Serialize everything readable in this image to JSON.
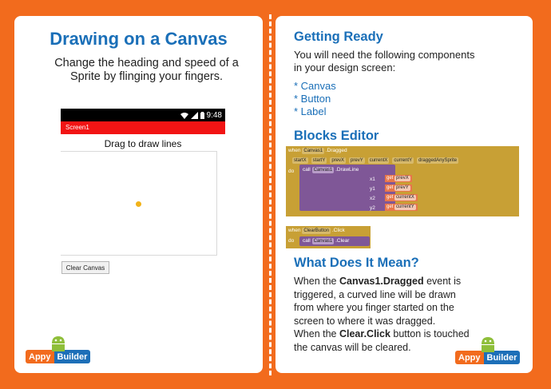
{
  "left": {
    "title": "Drawing on a Canvas",
    "subtitle": "Change the heading and speed of a Sprite by flinging your fingers.",
    "phone": {
      "time": "9:48",
      "screen_title": "Screen1",
      "label": "Drag to draw lines",
      "button": "Clear Canvas"
    }
  },
  "logo": {
    "appy": "Appy",
    "builder": "Builder"
  },
  "right": {
    "getting_ready": {
      "heading": "Getting Ready",
      "text_line1": "You will need the following components",
      "text_line2": "in your design screen:",
      "items": [
        "* Canvas",
        "* Button",
        "* Label"
      ]
    },
    "blocks_editor": {
      "heading": "Blocks Editor",
      "dragged": {
        "when": "when",
        "component": "Canvas1",
        "event": ".Dragged",
        "params": [
          "startX",
          "startY",
          "prevX",
          "prevY",
          "currentX",
          "currentY",
          "draggedAnySprite"
        ],
        "do": "do",
        "call": "call",
        "method": ".DrawLine",
        "args": [
          {
            "name": "x1",
            "value": "prevX"
          },
          {
            "name": "y1",
            "value": "prevY"
          },
          {
            "name": "x2",
            "value": "currentX"
          },
          {
            "name": "y2",
            "value": "currentY"
          }
        ],
        "get": "get"
      },
      "click": {
        "when": "when",
        "component": "ClearButton",
        "event": ".Click",
        "do": "do",
        "call": "call",
        "target": "Canvas1",
        "method": ".Clear"
      }
    },
    "meaning": {
      "heading": "What Does It Mean?",
      "p1_a": "When the ",
      "p1_b": "Canvas1.Dragged",
      "p1_c": " event is triggered, a curved line will be drawn from where you finger started on the screen to where it was dragged.",
      "p2_a": "When the ",
      "p2_b": "Clear.Click",
      "p2_c": " button is touched the canvas will be cleared."
    }
  },
  "colors": {
    "background": "#f26b1d",
    "heading": "#1a6fb8",
    "statusbar": "#000000",
    "titlebar": "#f21414"
  }
}
